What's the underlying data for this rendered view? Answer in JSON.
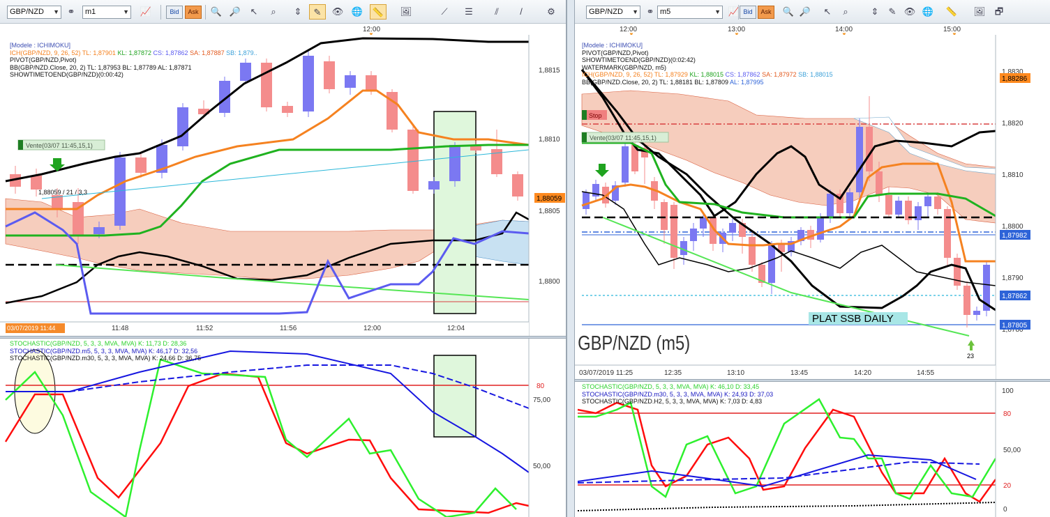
{
  "left": {
    "toolbar": {
      "symbol": "GBP/NZD",
      "timeframe": "m1",
      "bid": "Bid",
      "ask": "Ask"
    },
    "top_time": "12:00",
    "main": {
      "info": {
        "model": "[Modele : ICHIMOKU]",
        "ich": "ICH(GBP/NZD, 9, 26, 52)",
        "ich_tl": "TL: 1,87901",
        "ich_kl": "KL: 1,87872",
        "ich_cs": "CS: 1,87862",
        "ich_sa": "SA: 1,87887",
        "ich_sb": "SB: 1,879..",
        "pivot": "PIVOT(GBP/NZD,Pivot)",
        "bb": "BB(GBP/NZD.Close, 20, 2)  TL: 1,87953  BL: 1,87789  AL: 1,87871",
        "showtime": "SHOWTIMETOEND(GBP/NZD)(0:00:42)"
      },
      "axis": [
        "1,8815",
        "1,8810",
        "1,8805",
        "1,8800"
      ],
      "price_tag": "1,88059",
      "order_label": "Vente(03/07 11:45,15,1)",
      "trade_text": "1,88059 / 21 / 3,3",
      "xlabels": [
        "11:48",
        "11:52",
        "11:56",
        "12:00",
        "12:04"
      ],
      "date_label": "03/07/2019 11:44"
    },
    "stoch": {
      "l1": "STOCHASTIC(GBP/NZD, 5, 3, 3, MVA, MVA)  K: 11,73  D: 28,36",
      "l2": "STOCHASTIC(GBP/NZD.m5, 5, 3, 3, MVA, MVA)  K: 46,17  D: 32,56",
      "l3": "STOCHASTIC(GBP/NZD.m30, 5, 3, 3, MVA, MVA)  K: 24,66  D: 36,75",
      "axis": [
        "80",
        "75,00",
        "50,00"
      ]
    }
  },
  "right": {
    "toolbar": {
      "symbol": "GBP/NZD",
      "timeframe": "m5",
      "bid": "Bid",
      "ask": "Ask"
    },
    "top_times": [
      "12:00",
      "13:00",
      "14:00",
      "15:00"
    ],
    "main": {
      "info": {
        "model": "[Modele : ICHIMOKU]",
        "pivot": "PIVOT(GBP/NZD,Pivot)",
        "showtime": "SHOWTIMETOEND(GBP/NZD)(0:02:42)",
        "watermark": "WATERMARK(GBP/NZD, m5)",
        "ich": "ICH(GBP/NZD, 9, 26, 52)",
        "ich_tl": "TL: 1,87929",
        "ich_kl": "KL: 1,88015",
        "ich_cs": "CS: 1,87862",
        "ich_sa": "SA: 1,87972",
        "ich_sb": "SB: 1,88015",
        "bb": "BB(GBP/NZD.Close, 20, 2)  TL: 1,88181  BL: 1,87809",
        "bb_al": "AL: 1,87995"
      },
      "axis": [
        "1,8830",
        "1,8820",
        "1,8810",
        "1,8800",
        "1,8790",
        "1,8780"
      ],
      "tags": [
        "1,88286",
        "1,87982",
        "1,87862",
        "1,87805"
      ],
      "stop_label": "Stop",
      "order_label": "Vente(03/07 11:45,15,1)",
      "annotation": "PLAT SSB DAILY",
      "watermark": "GBP/NZD (m5)",
      "marker_count": "23",
      "xlabels": [
        "12:35",
        "13:10",
        "13:45",
        "14:20",
        "14:55"
      ],
      "date_label": "03/07/2019 11:25"
    },
    "stoch": {
      "l1": "STOCHASTIC(GBP/NZD, 5, 3, 3, MVA, MVA)  K: 46,10  D: 33,45",
      "l2": "STOCHASTIC(GBP/NZD.m30, 5, 3, 3, MVA, MVA)  K: 24,93  D: 37,03",
      "l3": "STOCHASTIC(GBP/NZD.H2, 5, 3, 3, MVA, MVA)  K: 7,03  D: 4,83",
      "axis": [
        "100",
        "80",
        "50,00",
        "20",
        "0"
      ]
    }
  },
  "colors": {
    "bull": "#7b78f2",
    "bear": "#f48c8c",
    "tenkan": "#f58220",
    "kijun": "#1fb21f",
    "bb": "#000000",
    "cloud": "#f6cdbd",
    "cloud2": "#c8e1f2",
    "ask_tag": "#ff8a1f",
    "blue_tag": "#2d63d8"
  }
}
